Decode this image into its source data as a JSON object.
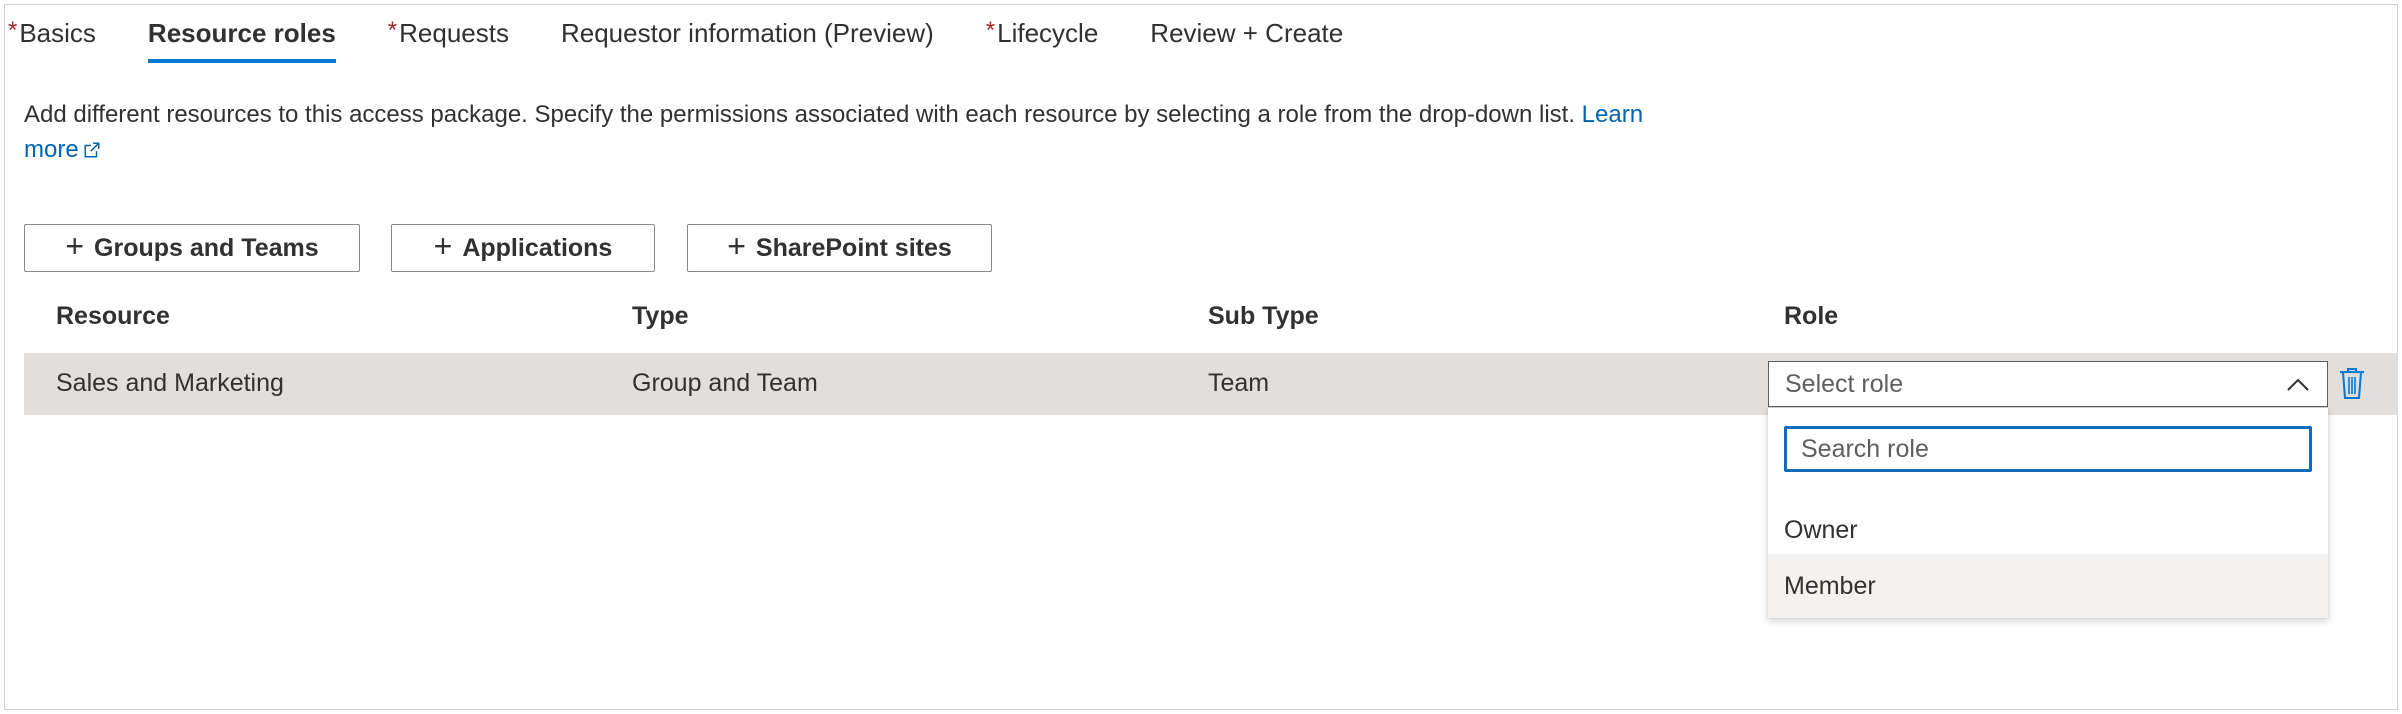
{
  "tabs": [
    {
      "label": "Basics",
      "required": true
    },
    {
      "label": "Resource roles",
      "required": false,
      "active": true
    },
    {
      "label": "Requests",
      "required": true
    },
    {
      "label": "Requestor information (Preview)",
      "required": false
    },
    {
      "label": "Lifecycle",
      "required": true
    },
    {
      "label": "Review + Create",
      "required": false
    }
  ],
  "required_marker": "*",
  "description": {
    "text": "Add different resources to this access package. Specify the permissions associated with each resource by selecting a role from the drop-down list.",
    "link": "Learn more"
  },
  "buttons": {
    "groups": "Groups and Teams",
    "applications": "Applications",
    "sharepoint": "SharePoint sites"
  },
  "table": {
    "headers": [
      "Resource",
      "Type",
      "Sub Type",
      "Role"
    ],
    "rows": [
      {
        "resource": "Sales and Marketing",
        "type": "Group and Team",
        "sub_type": "Team"
      }
    ]
  },
  "role_select": {
    "placeholder": "Select role",
    "search_placeholder": "Search role",
    "options": [
      "Owner",
      "Member"
    ]
  },
  "colors": {
    "accent": "#0078d4",
    "link": "#0063b1",
    "required": "#a4262c",
    "row_selected": "#e1dfdd",
    "option_hover": "#f3f2f1"
  }
}
